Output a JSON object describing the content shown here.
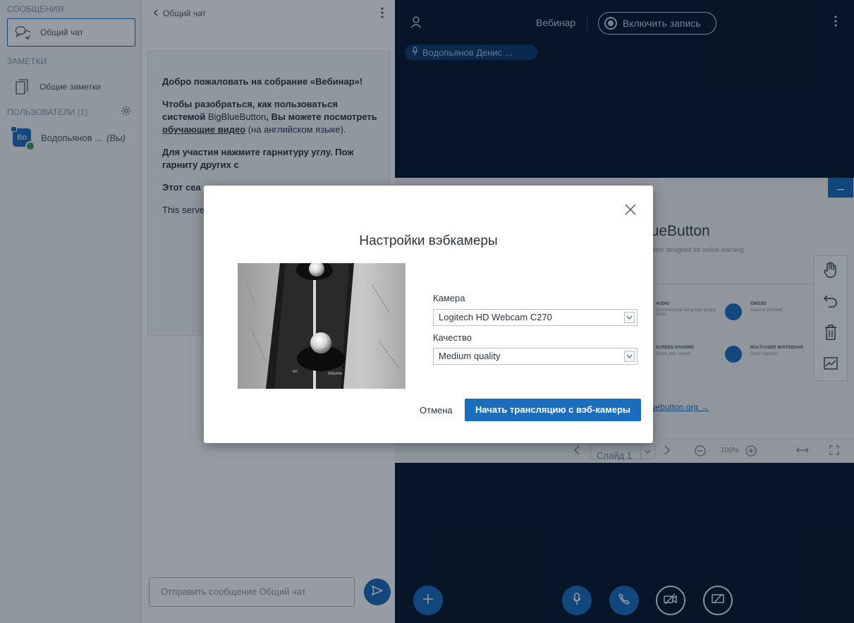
{
  "userlist": {
    "messages_title": "СООБЩЕНИЯ",
    "chat_item": "Общий чат",
    "notes_title": "ЗАМЕТКИ",
    "notes_item": "Общие заметки",
    "users_title": "ПОЛЬЗОВАТЕЛИ (1)",
    "user": {
      "avatar": "Bo",
      "name": "Водопьянов ...",
      "you": "(Вы)"
    }
  },
  "chat": {
    "title": "Общий чат",
    "welcome_heading_1": "Добро пожаловать на собрание «",
    "welcome_heading_name": "Вебинар",
    "welcome_heading_2": "»!",
    "welcome_p2_a": "Чтобы разобраться, как пользоваться системой ",
    "welcome_p2_brand": "BigBlueButton",
    "welcome_p2_b": ", Вы можете посмотреть ",
    "welcome_p2_link": "обучающие видео",
    "welcome_p2_c": " (на английском языке).",
    "welcome_p3": "Для участия нажмите гарнитуру углу. Пож гарниту других с",
    "welcome_p4": "Этот сеа",
    "welcome_p5": "This serve",
    "input_placeholder": "Отправить сообщение Общий чат"
  },
  "main": {
    "meeting_title": "Вебинар",
    "record_label": "Включить запись",
    "talker": "Водопьянов Денис ...",
    "slide": {
      "title": "lueButton",
      "subtitle": "stem designed for online learning",
      "features": [
        {
          "title": "AUDIO",
          "text": "Communicate using high quality audio."
        },
        {
          "title": "EMOJIS",
          "text": "Express yourself."
        },
        {
          "title": "SCREEN SHARING",
          "text": "Share your screen."
        },
        {
          "title": "MULTI-USER WHITEBOAR",
          "text": "Draw together."
        }
      ],
      "link": "luebutton.org →"
    },
    "slide_select": "Слайд 1",
    "zoom": "100%"
  },
  "modal": {
    "title": "Настройки вэбкамеры",
    "camera_label": "Камера",
    "camera_value": "Logitech HD Webcam C270",
    "quality_label": "Качество",
    "quality_value": "Medium quality",
    "cancel_label": "Отмена",
    "start_label": "Начать трансляцию с вэб-камеры",
    "preview_text_1": "on",
    "preview_text_2": "Volume"
  },
  "colors": {
    "accent": "#1b6dbd",
    "dark_bg": "#06172a",
    "panel_bg": "#f3f6f9"
  }
}
